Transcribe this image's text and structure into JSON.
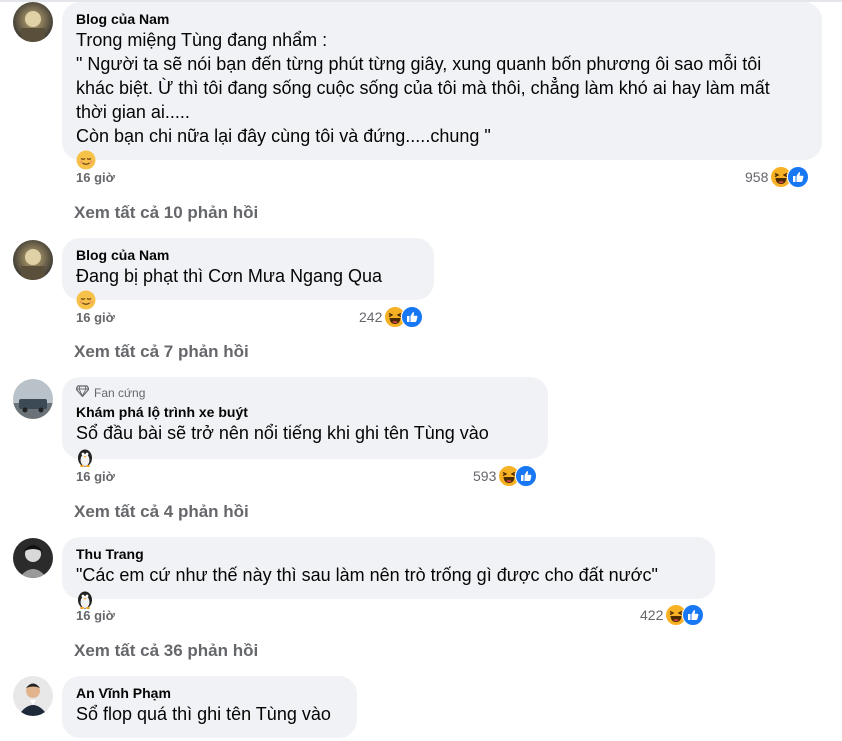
{
  "comments": [
    {
      "author": "Blog của Nam",
      "badge": "",
      "lines": [
        "Trong miệng Tùng đang nhẩm :",
        "\" Người ta sẽ nói bạn đến từng phút từng giây, xung quanh bốn phương ôi sao mỗi tôi",
        "khác biệt. Ừ thì tôi đang sống cuộc sống của tôi mà thôi, chẳng làm khó ai hay làm mất",
        "thời gian ai.....",
        "Còn bạn chi nữa lại đây cùng tôi và đứng.....chung \""
      ],
      "end_emoji": "relieved-face-icon",
      "time": "16 giờ",
      "reactions": "958",
      "see_replies": "Xem tất cả 10 phản hồi"
    },
    {
      "author": "Blog của Nam",
      "badge": "",
      "lines": [
        "Đang bị phạt thì Cơn Mưa Ngang Qua"
      ],
      "end_emoji": "relieved-face-icon",
      "time": "16 giờ",
      "reactions": "242",
      "see_replies": "Xem tất cả 7 phản hồi"
    },
    {
      "author": "Khám phá lộ trình xe buýt",
      "badge": "Fan cứng",
      "lines": [
        "Sổ đầu bài sẽ trở nên nổi tiếng khi ghi tên Tùng vào"
      ],
      "end_emoji": "penguin-icon",
      "time": "16 giờ",
      "reactions": "593",
      "see_replies": "Xem tất cả 4 phản hồi"
    },
    {
      "author": "Thu Trang",
      "badge": "",
      "lines": [
        "\"Các em cứ như thế này thì sau làm nên trò trống gì được cho đất nước\""
      ],
      "end_emoji": "penguin-icon",
      "time": "16 giờ",
      "reactions": "422",
      "see_replies": "Xem tất cả 36 phản hồi"
    },
    {
      "author": "An Vĩnh Phạm",
      "badge": "",
      "lines": [
        "Sổ flop quá thì ghi tên Tùng vào"
      ],
      "end_emoji": "",
      "time": "",
      "reactions": "",
      "see_replies": ""
    }
  ],
  "colors": {
    "bubble": "#f0f2f5",
    "secondary_text": "#65676b",
    "like_blue": "#1877f2",
    "haha_yellow": "#f7b125"
  },
  "icons": {
    "reaction_haha": "haha-reaction-icon",
    "reaction_like": "like-reaction-icon",
    "badge": "diamond-icon"
  }
}
